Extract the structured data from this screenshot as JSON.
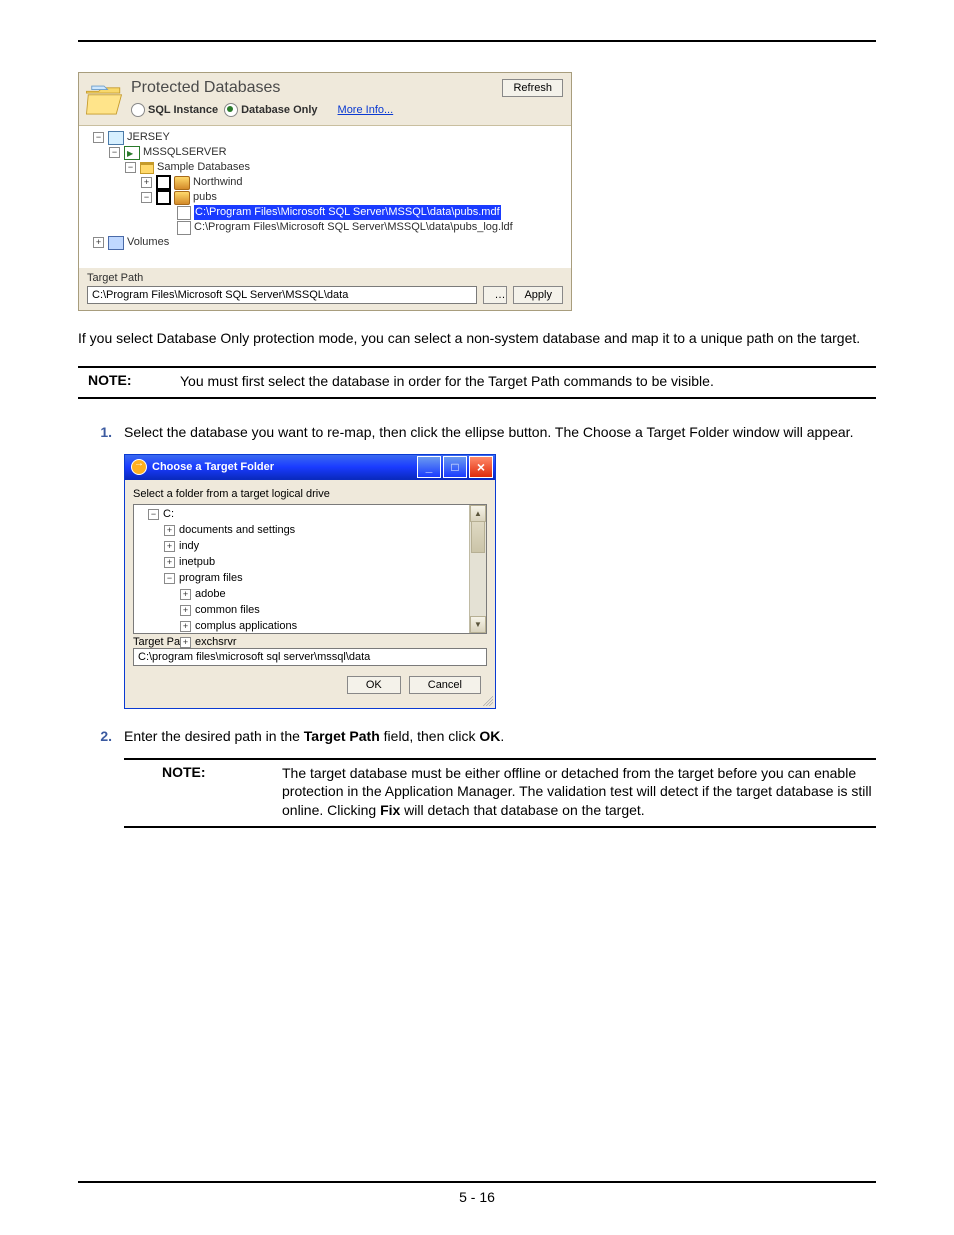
{
  "panel1": {
    "title": "Protected Databases",
    "refresh": "Refresh",
    "radio1": "SQL Instance",
    "radio2": "Database Only",
    "more_info": "More Info...",
    "tree": {
      "root": "JERSEY",
      "instance": "MSSQLSERVER",
      "sample_folder": "Sample Databases",
      "northwind": "Northwind",
      "pubs": "pubs",
      "mdf": "C:\\Program Files\\Microsoft SQL Server\\MSSQL\\data\\pubs.mdf",
      "ldf": "C:\\Program Files\\Microsoft SQL Server\\MSSQL\\data\\pubs_log.ldf",
      "volumes": "Volumes"
    },
    "target_label": "Target Path",
    "target_value": "C:\\Program Files\\Microsoft SQL Server\\MSSQL\\data",
    "apply": "Apply"
  },
  "para1": "If you select Database Only protection mode, you can select a non-system database and map it to a unique path on the target.",
  "note1": {
    "label": "NOTE:",
    "body": "You must first select the database in order for the Target Path commands to be visible."
  },
  "step1": {
    "num": "1.",
    "body": "Select the database you want to re-map, then click the ellipse button. The Choose a Target Folder window will appear."
  },
  "panel2": {
    "title": "Choose a Target Folder",
    "sub": "Select a folder from a target logical drive",
    "tree": {
      "c": "C:",
      "n1": "documents and settings",
      "n2": "indy",
      "n3": "inetpub",
      "n4": "program files",
      "n4a": "adobe",
      "n4b": "common files",
      "n4c": "complus applications",
      "n4d": "exchsrvr"
    },
    "target_label": "Target Path",
    "target_value": "C:\\program files\\microsoft sql server\\mssql\\data",
    "ok": "OK",
    "cancel": "Cancel"
  },
  "step2": {
    "num": "2.",
    "body_pre": "Enter the desired path in the ",
    "body_b1": "Target Path",
    "body_mid": " field, then click ",
    "body_b2": "OK",
    "body_post": "."
  },
  "note2": {
    "label": "NOTE:",
    "body_pre": "The target database must be either offline or detached from the target before you can enable protection in the Application Manager. The validation test will detect if the target database is still online. Clicking ",
    "body_b": "Fix",
    "body_post": " will detach that database on the target."
  },
  "footer": "5 - 16"
}
